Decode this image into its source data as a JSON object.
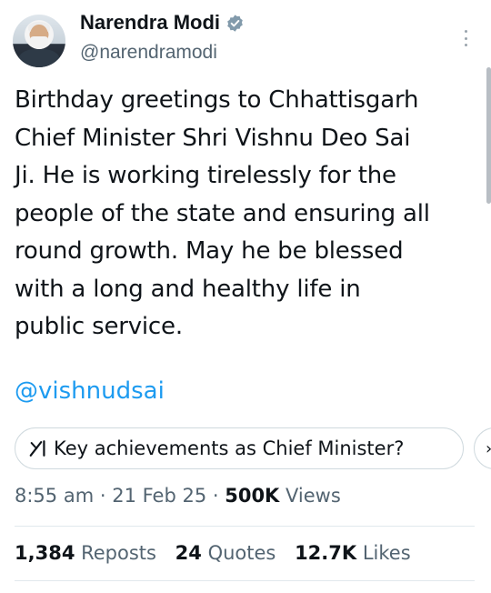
{
  "author": {
    "display_name": "Narendra Modi",
    "handle": "@narendramodi",
    "verified_icon": "verified-badge-icon",
    "avatar_icon": "avatar"
  },
  "tweet": {
    "lines": [
      "Birthday greetings to Chhattisgarh",
      "Chief Minister Shri Vishnu Deo Sai",
      "Ji. He is working tirelessly for the",
      "people of the state and ensuring all",
      "round growth. May he be blessed",
      "with a long and healthy life in",
      "public service."
    ],
    "mention": "@vishnudsai"
  },
  "grok_prompt": {
    "label": "Key achievements as Chief Minister?",
    "next_glyph": "›"
  },
  "meta": {
    "time": "8:55 am",
    "sep1": " · ",
    "date": "21 Feb 25",
    "sep2": " · ",
    "views_count": "500K",
    "views_label": " Views"
  },
  "stats": {
    "reposts_count": "1,384",
    "reposts_label": " Reposts",
    "quotes_count": "24",
    "quotes_label": " Quotes",
    "likes_count": "12.7K",
    "likes_label": " Likes"
  },
  "colors": {
    "text": "#0f1419",
    "secondary": "#536471",
    "link": "#1d9bf0",
    "verified": "#829aab",
    "border": "#cfd9de"
  }
}
